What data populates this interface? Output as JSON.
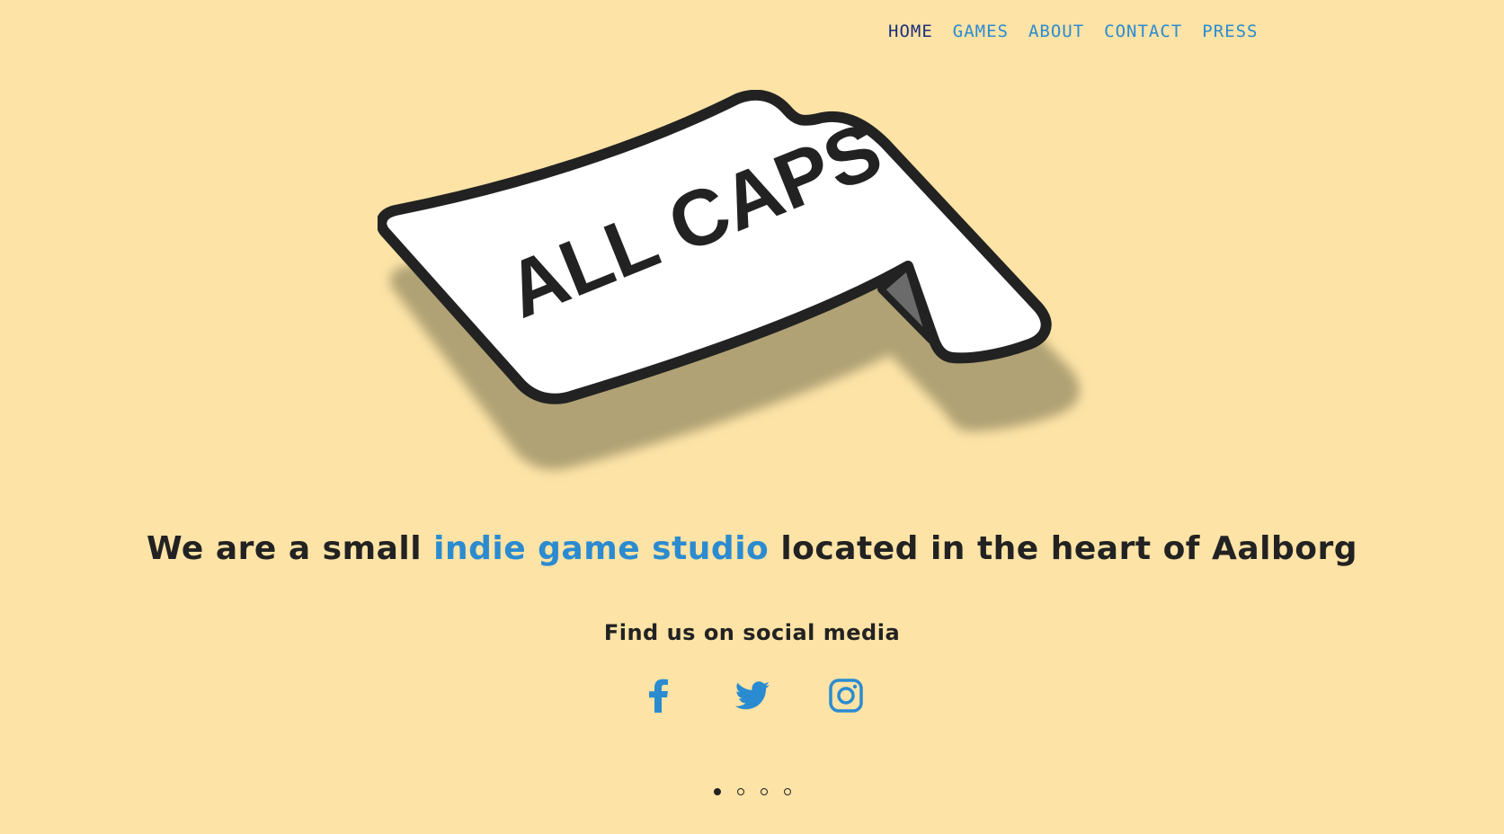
{
  "nav": {
    "items": [
      {
        "label": "HOME",
        "active": true
      },
      {
        "label": "GAMES",
        "active": false
      },
      {
        "label": "ABOUT",
        "active": false
      },
      {
        "label": "CONTACT",
        "active": false
      },
      {
        "label": "PRESS",
        "active": false
      }
    ]
  },
  "logo": {
    "text": "ALL CAPS"
  },
  "hero": {
    "tagline_before": "We are a small ",
    "tagline_highlight": "indie game studio",
    "tagline_after": " located in the heart of Aalborg"
  },
  "social": {
    "title": "Find us on social media",
    "icons": [
      "facebook-icon",
      "twitter-icon",
      "instagram-icon"
    ]
  },
  "slider": {
    "dot_count": 4,
    "active_index": 0
  },
  "colors": {
    "background": "#fde3a6",
    "accent": "#2b8bd0",
    "nav_active": "#1e2f7a",
    "text": "#222222"
  }
}
